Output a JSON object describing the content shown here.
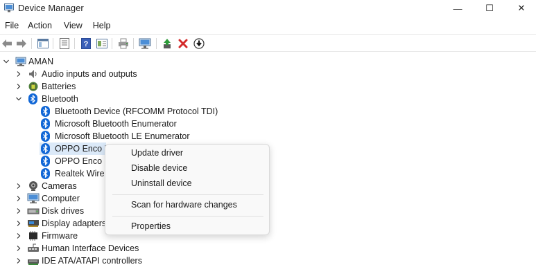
{
  "window": {
    "title": "Device Manager",
    "minimize": "—",
    "maximize": "☐",
    "close": "✕"
  },
  "menu": [
    "File",
    "Action",
    "View",
    "Help"
  ],
  "toolbar": {
    "icons": [
      "back-icon",
      "forward-icon",
      "show-hide-icon",
      "properties-icon",
      "help-icon",
      "view-icon",
      "print-icon",
      "scan-monitor-icon",
      "update-driver-icon",
      "uninstall-icon",
      "download-icon"
    ]
  },
  "tree": {
    "root": "AMAN",
    "nodes": [
      {
        "label": "Audio inputs and outputs",
        "icon": "speaker-icon",
        "expanded": false
      },
      {
        "label": "Batteries",
        "icon": "battery-icon",
        "expanded": false
      },
      {
        "label": "Bluetooth",
        "icon": "bluetooth-icon",
        "expanded": true
      },
      {
        "label": "Cameras",
        "icon": "camera-icon",
        "expanded": false
      },
      {
        "label": "Computer",
        "icon": "computer-icon",
        "expanded": false
      },
      {
        "label": "Disk drives",
        "icon": "disk-drive-icon",
        "expanded": false
      },
      {
        "label": "Display adapters",
        "icon": "display-adapter-icon",
        "expanded": false
      },
      {
        "label": "Firmware",
        "icon": "firmware-icon",
        "expanded": false
      },
      {
        "label": "Human Interface Devices",
        "icon": "hid-icon",
        "expanded": false
      },
      {
        "label": "IDE ATA/ATAPI controllers",
        "icon": "ide-controller-icon",
        "expanded": false
      }
    ],
    "bluetooth_children": [
      "Bluetooth Device (RFCOMM Protocol TDI)",
      "Microsoft Bluetooth Enumerator",
      "Microsoft Bluetooth LE Enumerator",
      "OPPO Enco B",
      "OPPO Enco B",
      "Realtek Wirele"
    ]
  },
  "context_menu": {
    "items": [
      "Update driver",
      "Disable device",
      "Uninstall device",
      "Scan for hardware changes",
      "Properties"
    ]
  },
  "colors": {
    "bluetooth": "#1167d6",
    "selection": "#dbe9f8",
    "uninstall_red": "#d42b2b",
    "update_green": "#2e9b3a"
  }
}
